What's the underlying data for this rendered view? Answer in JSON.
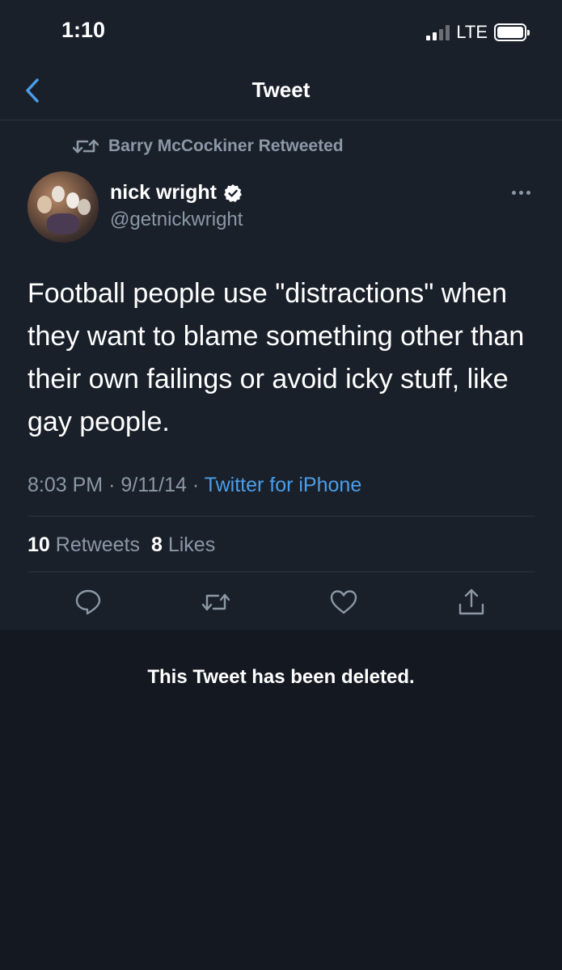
{
  "status_bar": {
    "time": "1:10",
    "network": "LTE"
  },
  "nav": {
    "title": "Tweet",
    "back_icon": "chevron-left-icon"
  },
  "retweet_banner": {
    "label": "Barry McCockiner Retweeted"
  },
  "tweet": {
    "author_name": "nick wright",
    "author_handle": "@getnickwright",
    "verified": true,
    "text": "Football people use \"distractions\" when they want to blame something other than their own failings or avoid icky stuff, like gay people.",
    "time": "8:03 PM",
    "date": "9/11/14",
    "source": "Twitter for iPhone",
    "retweet_count": "10",
    "retweet_label": "Retweets",
    "like_count": "8",
    "like_label": "Likes"
  },
  "reply_notice": "This Tweet has been deleted.",
  "colors": {
    "background": "#141921",
    "card": "#1a202a",
    "accent": "#4a9eea",
    "muted": "#8b98a5",
    "divider": "#2f3640"
  }
}
